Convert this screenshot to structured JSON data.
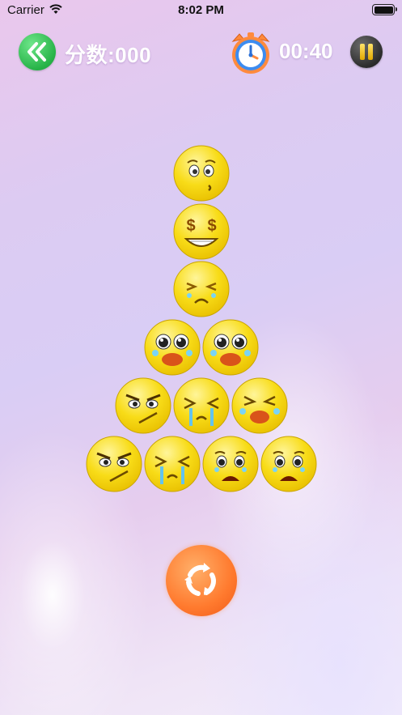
{
  "status_bar": {
    "carrier": "Carrier",
    "time": "8:02 PM"
  },
  "header": {
    "score_text": "分数:000",
    "timer_text": "00:40",
    "back_icon": "double-chevron-left-icon",
    "clock_icon": "alarm-clock-icon",
    "pause_icon": "pause-icon"
  },
  "board": {
    "rows": [
      [
        "worried",
        "money-eyes"
      ],
      [
        "crying-squint"
      ],
      [
        "wailing",
        "wailing"
      ],
      [
        "angry-frown",
        "crying-streams",
        "wailing-squint"
      ],
      [
        "angry-frown",
        "crying-streams",
        "sad-teary",
        "sad-teary"
      ]
    ]
  },
  "footer": {
    "refresh_icon": "refresh-icon"
  },
  "colors": {
    "green": "#27b348",
    "orange": "#ff7a2e",
    "face": "#f5d70e"
  }
}
